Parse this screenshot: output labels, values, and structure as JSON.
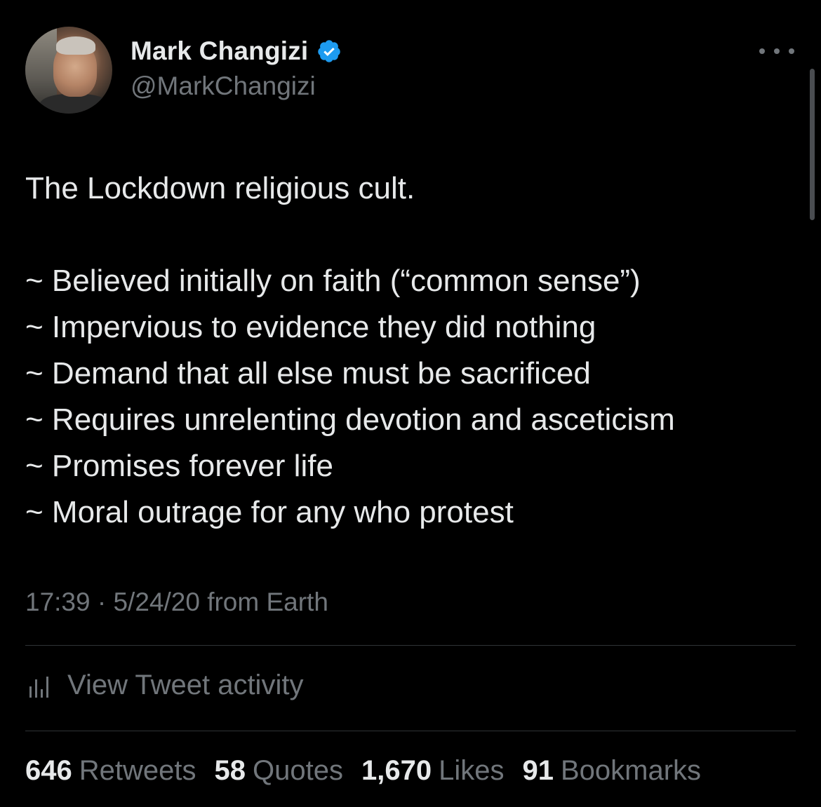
{
  "author": {
    "display_name": "Mark Changizi",
    "handle": "@MarkChangizi",
    "verified_color": "#1d9bf0"
  },
  "tweet": {
    "lines": [
      "The Lockdown religious cult.",
      "",
      "~ Believed initially on faith (“common sense”)",
      "~ Impervious to evidence they did nothing",
      "~ Demand that all else must be sacrificed",
      "~ Requires unrelenting devotion and asceticism",
      "~ Promises forever life",
      "~ Moral outrage for any who protest"
    ],
    "timestamp": "17:39 · 5/24/20 from Earth"
  },
  "activity": {
    "label": "View Tweet activity",
    "icon": "bar-chart-icon"
  },
  "stats": [
    {
      "count": "646",
      "label": "Retweets"
    },
    {
      "count": "58",
      "label": "Quotes"
    },
    {
      "count": "1,670",
      "label": "Likes"
    },
    {
      "count": "91",
      "label": "Bookmarks"
    }
  ],
  "colors": {
    "background": "#000000",
    "text": "#e7e9ea",
    "secondary": "#71767b",
    "divider": "#2f3336"
  }
}
